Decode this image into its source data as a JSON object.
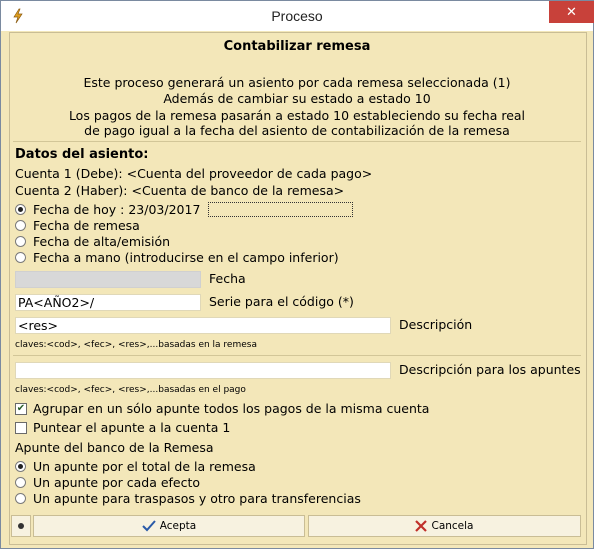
{
  "window": {
    "title": "Proceso",
    "close_glyph": "✕"
  },
  "heading": "Contabilizar remesa",
  "info": [
    "Este proceso generará un asiento por cada remesa seleccionada (1)",
    "Además de cambiar su estado a estado 10",
    "Los pagos de la remesa pasarán a estado 10 estableciendo su fecha real",
    "de pago igual a la fecha del asiento de contabilización de la remesa"
  ],
  "datos": {
    "title": "Datos del asiento:",
    "cuenta1": "Cuenta 1 (Debe): <Cuenta del proveedor de cada pago>",
    "cuenta2": "Cuenta 2 (Haber): <Cuenta de banco de la remesa>"
  },
  "fecha_options": [
    "Fecha de hoy : 23/03/2017",
    "Fecha de remesa",
    "Fecha de alta/emisión",
    "Fecha a mano (introducirse en el campo inferior)"
  ],
  "fecha_selected_index": 0,
  "fields": {
    "fecha": {
      "label": "Fecha",
      "value": ""
    },
    "serie": {
      "label": "Serie para el código (*)",
      "value": "PA<AÑO2>/"
    },
    "descripcion": {
      "label": "Descripción",
      "value": "<res>",
      "hint": "claves:<cod>, <fec>, <res>,...basadas en la remesa"
    },
    "descripcion_apuntes": {
      "label": "Descripción para los apuntes",
      "value": "",
      "hint": "claves:<cod>, <fec>, <res>,...basadas en el pago"
    }
  },
  "checks": {
    "agrupar": {
      "label": "Agrupar en un sólo apunte todos los pagos de la misma cuenta",
      "checked": true
    },
    "puntear": {
      "label": "Puntear el apunte a la cuenta 1",
      "checked": false
    }
  },
  "apunte_banco": {
    "title": "Apunte del banco de la Remesa",
    "options": [
      "Un apunte por el total de la remesa",
      "Un apunte por cada efecto",
      "Un apunte para traspasos y otro para transferencias"
    ],
    "selected_index": 0
  },
  "buttons": {
    "acepta": "Acepta",
    "cancela": "Cancela"
  },
  "colors": {
    "background": "#f3e7b9",
    "close": "#c8413a",
    "accept_icon": "#2a5aa8",
    "cancel_icon": "#c0302a"
  }
}
